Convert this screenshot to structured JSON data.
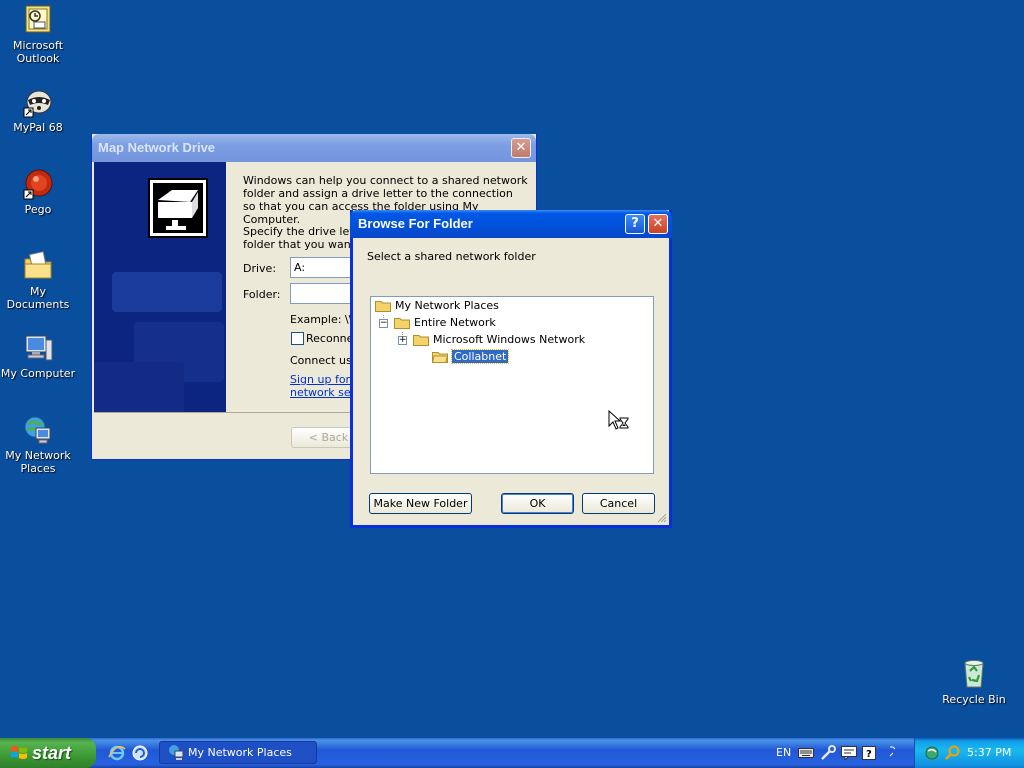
{
  "desktop": {
    "icons": [
      {
        "label": "Microsoft Outlook",
        "icon": "outlook-icon"
      },
      {
        "label": "MyPal 68",
        "icon": "mypal-icon"
      },
      {
        "label": "Pego",
        "icon": "pego-icon"
      },
      {
        "label": "My Documents",
        "icon": "my-documents-icon"
      },
      {
        "label": "My Computer",
        "icon": "my-computer-icon"
      },
      {
        "label": "My Network Places",
        "icon": "my-network-places-icon"
      },
      {
        "label": "Recycle Bin",
        "icon": "recycle-bin-icon"
      }
    ]
  },
  "map_drive": {
    "title": "Map Network Drive",
    "intro": "Windows can help you connect to a shared network folder and assign a drive letter to the connection so that you can access the folder using My Computer.",
    "specify": "Specify the drive letter for the connection and the folder that you want to connect to:",
    "drive_label": "Drive:",
    "drive_value": "A:",
    "folder_label": "Folder:",
    "folder_value": "",
    "example": "Example: \\\\s",
    "reconnect_label": "Reconnect",
    "connect_using": "Connect usin",
    "signup_line1": "Sign up for o",
    "signup_line2": "network serv",
    "back_button": "< Back"
  },
  "browse": {
    "title": "Browse For Folder",
    "help_glyph": "?",
    "close_glyph": "✕",
    "instruction": "Select a shared network folder",
    "tree": [
      {
        "label": "My Network Places",
        "expander": ""
      },
      {
        "label": "Entire Network",
        "expander": "−"
      },
      {
        "label": "Microsoft Windows Network",
        "expander": "+"
      },
      {
        "label": "Collabnet",
        "expander": "",
        "selected": true
      }
    ],
    "make_new_folder": "Make New Folder",
    "ok": "OK",
    "cancel": "Cancel"
  },
  "taskbar": {
    "start_label": "start",
    "task_label": "My Network Places",
    "lang": "EN",
    "clock": "5:37 PM"
  },
  "colors": {
    "desktop": "#0a4e9e",
    "title_active": "#0058e6",
    "selection": "#316ac5"
  }
}
